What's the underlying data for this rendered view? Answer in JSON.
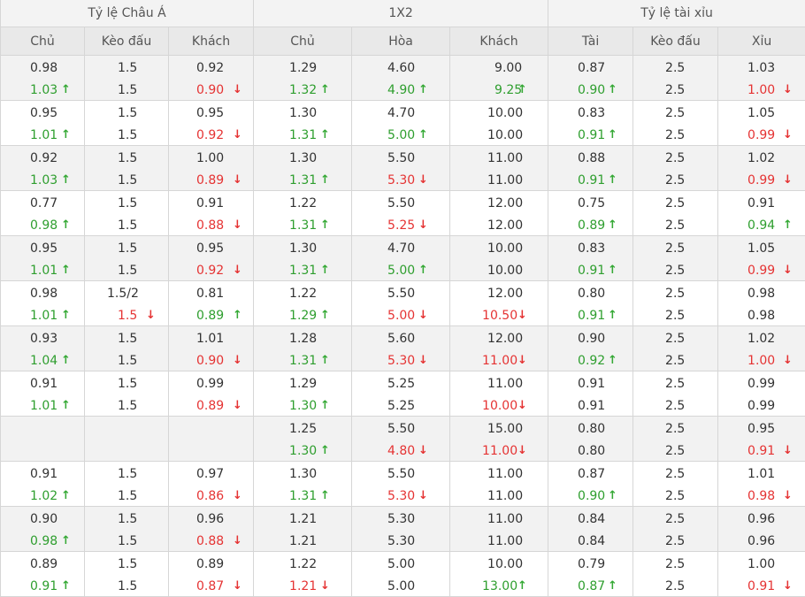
{
  "headers": {
    "groups": [
      "Tỷ lệ Châu Á",
      "1X2",
      "Tỷ lệ tài xỉu"
    ],
    "columns": [
      "Chủ",
      "Kèo đấu",
      "Khách",
      "Chủ",
      "Hòa",
      "Khách",
      "Tài",
      "Kèo đấu",
      "Xỉu"
    ]
  },
  "arrows": {
    "up": "↑",
    "down": "↓"
  },
  "colors": {
    "up": "#2e9e2e",
    "down": "#e53333",
    "header_bg": "#e9e9e9",
    "alt_row_bg": "#f2f2f2"
  },
  "rows": [
    {
      "cells": [
        {
          "top": "0.98",
          "bot": "1.03",
          "dir": "up"
        },
        {
          "top": "1.5",
          "bot": "1.5"
        },
        {
          "top": "0.92",
          "bot": "0.90",
          "dir": "down"
        },
        {
          "top": "1.29",
          "bot": "1.32",
          "dir": "up"
        },
        {
          "top": "4.60",
          "bot": "4.90",
          "dir": "up"
        },
        {
          "top": "9.00",
          "bot": "9.25",
          "dir": "up"
        },
        {
          "top": "0.87",
          "bot": "0.90",
          "dir": "up"
        },
        {
          "top": "2.5",
          "bot": "2.5"
        },
        {
          "top": "1.03",
          "bot": "1.00",
          "dir": "down"
        }
      ]
    },
    {
      "cells": [
        {
          "top": "0.95",
          "bot": "1.01",
          "dir": "up"
        },
        {
          "top": "1.5",
          "bot": "1.5"
        },
        {
          "top": "0.95",
          "bot": "0.92",
          "dir": "down"
        },
        {
          "top": "1.30",
          "bot": "1.31",
          "dir": "up"
        },
        {
          "top": "4.70",
          "bot": "5.00",
          "dir": "up"
        },
        {
          "top": "10.00",
          "bot": "10.00"
        },
        {
          "top": "0.83",
          "bot": "0.91",
          "dir": "up"
        },
        {
          "top": "2.5",
          "bot": "2.5"
        },
        {
          "top": "1.05",
          "bot": "0.99",
          "dir": "down"
        }
      ]
    },
    {
      "cells": [
        {
          "top": "0.92",
          "bot": "1.03",
          "dir": "up"
        },
        {
          "top": "1.5",
          "bot": "1.5"
        },
        {
          "top": "1.00",
          "bot": "0.89",
          "dir": "down"
        },
        {
          "top": "1.30",
          "bot": "1.31",
          "dir": "up"
        },
        {
          "top": "5.50",
          "bot": "5.30",
          "dir": "down"
        },
        {
          "top": "11.00",
          "bot": "11.00"
        },
        {
          "top": "0.88",
          "bot": "0.91",
          "dir": "up"
        },
        {
          "top": "2.5",
          "bot": "2.5"
        },
        {
          "top": "1.02",
          "bot": "0.99",
          "dir": "down"
        }
      ]
    },
    {
      "cells": [
        {
          "top": "0.77",
          "bot": "0.98",
          "dir": "up"
        },
        {
          "top": "1.5",
          "bot": "1.5"
        },
        {
          "top": "0.91",
          "bot": "0.88",
          "dir": "down"
        },
        {
          "top": "1.22",
          "bot": "1.31",
          "dir": "up"
        },
        {
          "top": "5.50",
          "bot": "5.25",
          "dir": "down"
        },
        {
          "top": "12.00",
          "bot": "12.00"
        },
        {
          "top": "0.75",
          "bot": "0.89",
          "dir": "up"
        },
        {
          "top": "2.5",
          "bot": "2.5"
        },
        {
          "top": "0.91",
          "bot": "0.94",
          "dir": "up"
        }
      ]
    },
    {
      "cells": [
        {
          "top": "0.95",
          "bot": "1.01",
          "dir": "up"
        },
        {
          "top": "1.5",
          "bot": "1.5"
        },
        {
          "top": "0.95",
          "bot": "0.92",
          "dir": "down"
        },
        {
          "top": "1.30",
          "bot": "1.31",
          "dir": "up"
        },
        {
          "top": "4.70",
          "bot": "5.00",
          "dir": "up"
        },
        {
          "top": "10.00",
          "bot": "10.00"
        },
        {
          "top": "0.83",
          "bot": "0.91",
          "dir": "up"
        },
        {
          "top": "2.5",
          "bot": "2.5"
        },
        {
          "top": "1.05",
          "bot": "0.99",
          "dir": "down"
        }
      ]
    },
    {
      "cells": [
        {
          "top": "0.98",
          "bot": "1.01",
          "dir": "up"
        },
        {
          "top": "1.5/2",
          "bot": "1.5",
          "dir": "down"
        },
        {
          "top": "0.81",
          "bot": "0.89",
          "dir": "up"
        },
        {
          "top": "1.22",
          "bot": "1.29",
          "dir": "up"
        },
        {
          "top": "5.50",
          "bot": "5.00",
          "dir": "down"
        },
        {
          "top": "12.00",
          "bot": "10.50",
          "dir": "down"
        },
        {
          "top": "0.80",
          "bot": "0.91",
          "dir": "up"
        },
        {
          "top": "2.5",
          "bot": "2.5"
        },
        {
          "top": "0.98",
          "bot": "0.98"
        }
      ]
    },
    {
      "cells": [
        {
          "top": "0.93",
          "bot": "1.04",
          "dir": "up"
        },
        {
          "top": "1.5",
          "bot": "1.5"
        },
        {
          "top": "1.01",
          "bot": "0.90",
          "dir": "down"
        },
        {
          "top": "1.28",
          "bot": "1.31",
          "dir": "up"
        },
        {
          "top": "5.60",
          "bot": "5.30",
          "dir": "down"
        },
        {
          "top": "12.00",
          "bot": "11.00",
          "dir": "down"
        },
        {
          "top": "0.90",
          "bot": "0.92",
          "dir": "up"
        },
        {
          "top": "2.5",
          "bot": "2.5"
        },
        {
          "top": "1.02",
          "bot": "1.00",
          "dir": "down"
        }
      ]
    },
    {
      "cells": [
        {
          "top": "0.91",
          "bot": "1.01",
          "dir": "up"
        },
        {
          "top": "1.5",
          "bot": "1.5"
        },
        {
          "top": "0.99",
          "bot": "0.89",
          "dir": "down"
        },
        {
          "top": "1.29",
          "bot": "1.30",
          "dir": "up"
        },
        {
          "top": "5.25",
          "bot": "5.25"
        },
        {
          "top": "11.00",
          "bot": "10.00",
          "dir": "down"
        },
        {
          "top": "0.91",
          "bot": "0.91"
        },
        {
          "top": "2.5",
          "bot": "2.5"
        },
        {
          "top": "0.99",
          "bot": "0.99"
        }
      ]
    },
    {
      "cells": [
        {
          "top": "",
          "bot": ""
        },
        {
          "top": "",
          "bot": ""
        },
        {
          "top": "",
          "bot": ""
        },
        {
          "top": "1.25",
          "bot": "1.30",
          "dir": "up"
        },
        {
          "top": "5.50",
          "bot": "4.80",
          "dir": "down"
        },
        {
          "top": "15.00",
          "bot": "11.00",
          "dir": "down"
        },
        {
          "top": "0.80",
          "bot": "0.80"
        },
        {
          "top": "2.5",
          "bot": "2.5"
        },
        {
          "top": "0.95",
          "bot": "0.91",
          "dir": "down"
        }
      ]
    },
    {
      "cells": [
        {
          "top": "0.91",
          "bot": "1.02",
          "dir": "up"
        },
        {
          "top": "1.5",
          "bot": "1.5"
        },
        {
          "top": "0.97",
          "bot": "0.86",
          "dir": "down"
        },
        {
          "top": "1.30",
          "bot": "1.31",
          "dir": "up"
        },
        {
          "top": "5.50",
          "bot": "5.30",
          "dir": "down"
        },
        {
          "top": "11.00",
          "bot": "11.00"
        },
        {
          "top": "0.87",
          "bot": "0.90",
          "dir": "up"
        },
        {
          "top": "2.5",
          "bot": "2.5"
        },
        {
          "top": "1.01",
          "bot": "0.98",
          "dir": "down"
        }
      ]
    },
    {
      "cells": [
        {
          "top": "0.90",
          "bot": "0.98",
          "dir": "up"
        },
        {
          "top": "1.5",
          "bot": "1.5"
        },
        {
          "top": "0.96",
          "bot": "0.88",
          "dir": "down"
        },
        {
          "top": "1.21",
          "bot": "1.21"
        },
        {
          "top": "5.30",
          "bot": "5.30"
        },
        {
          "top": "11.00",
          "bot": "11.00"
        },
        {
          "top": "0.84",
          "bot": "0.84"
        },
        {
          "top": "2.5",
          "bot": "2.5"
        },
        {
          "top": "0.96",
          "bot": "0.96"
        }
      ]
    },
    {
      "cells": [
        {
          "top": "0.89",
          "bot": "0.91",
          "dir": "up"
        },
        {
          "top": "1.5",
          "bot": "1.5"
        },
        {
          "top": "0.89",
          "bot": "0.87",
          "dir": "down"
        },
        {
          "top": "1.22",
          "bot": "1.21",
          "dir": "down"
        },
        {
          "top": "5.00",
          "bot": "5.00"
        },
        {
          "top": "10.00",
          "bot": "13.00",
          "dir": "up"
        },
        {
          "top": "0.79",
          "bot": "0.87",
          "dir": "up"
        },
        {
          "top": "2.5",
          "bot": "2.5"
        },
        {
          "top": "1.00",
          "bot": "0.91",
          "dir": "down"
        }
      ]
    }
  ]
}
